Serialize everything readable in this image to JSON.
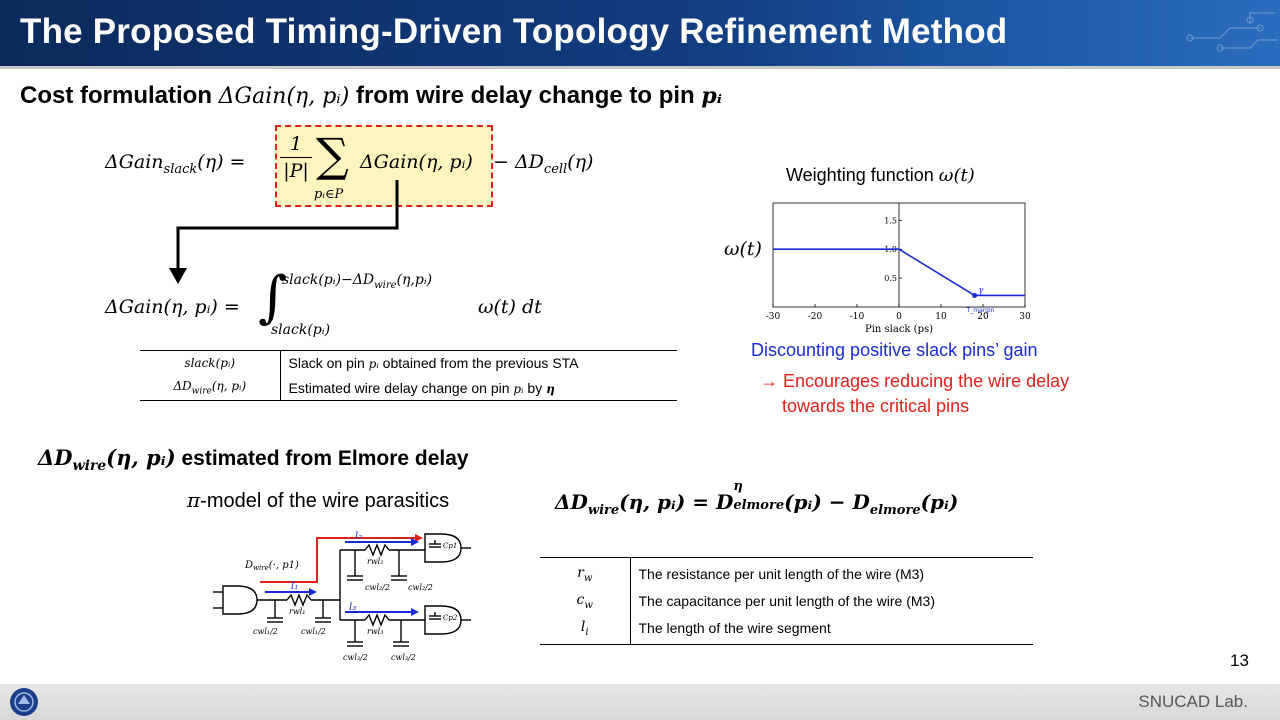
{
  "slide": {
    "title": "The Proposed Timing-Driven Topology Refinement Method",
    "page_number": "13",
    "footer_lab": "SNUCAD Lab."
  },
  "cost_section": {
    "heading_pre": "Cost formulation ",
    "heading_math": "ΔGain(η, pᵢ)",
    "heading_post": " from wire delay change to pin ",
    "heading_pin": "pᵢ",
    "eq1_lhs": "ΔGain",
    "eq1_lhs_sub": "slack",
    "eq1_lhs_arg": "(η) =",
    "eq1_frac_num": "1",
    "eq1_frac_den": "|P|",
    "eq1_sum_sub": "pᵢ∈P",
    "eq1_term": "ΔGain(η, pᵢ)",
    "eq1_tail": "− ΔD",
    "eq1_tail_sub": "cell",
    "eq1_tail_arg": "(η)",
    "eq2_lhs": "ΔGain(η, pᵢ) =",
    "eq2_upper": "slack(pᵢ)−ΔD",
    "eq2_upper_sub": "wire",
    "eq2_upper_arg": "(η,pᵢ)",
    "eq2_lower": "slack(pᵢ)",
    "eq2_integrand": "ω(t) dt"
  },
  "definitions_table": [
    {
      "sym": "slack(pᵢ)",
      "sub": "",
      "desc_pre": "Slack on pin ",
      "desc_math": "pᵢ",
      "desc_post": " obtained from the previous STA"
    },
    {
      "sym": "ΔD",
      "sub": "wire",
      "sym_arg": "(η, pᵢ)",
      "desc_pre": "Estimated wire delay change on pin ",
      "desc_math": "pᵢ",
      "desc_post": " by ",
      "desc_tail": "η"
    }
  ],
  "weighting": {
    "label_pre": "Weighting function ",
    "label_math": "ω(t)",
    "y_label": "ω(t)",
    "caption": "Discounting positive slack pins’ gain",
    "note_line1": "→ Encourages reducing the wire delay",
    "note_line2": "towards the critical pins",
    "caption_color": "#1a2bd6",
    "note_color": "#e0201a"
  },
  "chart_data": {
    "type": "line",
    "xlabel": "Pin slack (ps)",
    "ylabel": "",
    "xlim": [
      -30,
      30
    ],
    "ylim": [
      0,
      1.8
    ],
    "x_ticks": [
      "-30",
      "-20",
      "-10",
      "0",
      "10",
      "20",
      "30"
    ],
    "y_ticks": [
      "0.5",
      "1.0",
      "1.5"
    ],
    "x_tick_values": [
      -30,
      -20,
      -10,
      0,
      10,
      20,
      30
    ],
    "y_tick_values": [
      0.5,
      1.0,
      1.5
    ],
    "series": [
      {
        "x": [
          -30,
          0,
          18,
          30
        ],
        "y": [
          1.0,
          1.0,
          0.2,
          0.2
        ]
      }
    ],
    "annotations": [
      {
        "text": "γ",
        "x": 18,
        "y": 0.2
      },
      {
        "text": "T_margin",
        "x": 18,
        "y": 0
      }
    ],
    "line_color": "#1a2bd6",
    "grid": false
  },
  "elmore_section": {
    "heading_math": "ΔD",
    "heading_sub": "wire",
    "heading_arg": "(η, pᵢ)",
    "heading_text": " estimated from Elmore delay",
    "pi_model_math": "π",
    "pi_model_text": "-model of the wire parasitics",
    "eq_lhs": "ΔD",
    "eq_lhs_sub": "wire",
    "eq_lhs_arg": "(η, pᵢ) = D",
    "eq_sup": "η",
    "eq_sub1": "elmore",
    "eq_mid": "(pᵢ) − D",
    "eq_sub2": "elmore",
    "eq_end": "(pᵢ)"
  },
  "circuit": {
    "dwire_label": "D",
    "dwire_sub": "wire",
    "dwire_arg": "(·, p1)",
    "l1": "l₁",
    "l2": "l₂",
    "l3": "l₃",
    "rw_l1": "rwl₁",
    "rw_l2": "rwl₂",
    "rw_l3": "rwl₃",
    "cap_half_1": "cwl₁/2",
    "cap_half_2": "cwl₂/2",
    "cap_half_3": "cwl₃/2",
    "cp1": "Cp1",
    "cp2": "Cp2"
  },
  "params_table": [
    {
      "sym": "r",
      "sub": "w",
      "desc": "The resistance per unit length of the wire (M3)"
    },
    {
      "sym": "c",
      "sub": "w",
      "desc": "The capacitance per unit length of the wire (M3)"
    },
    {
      "sym": "l",
      "sub": "i",
      "desc": "The length of the wire segment"
    }
  ]
}
